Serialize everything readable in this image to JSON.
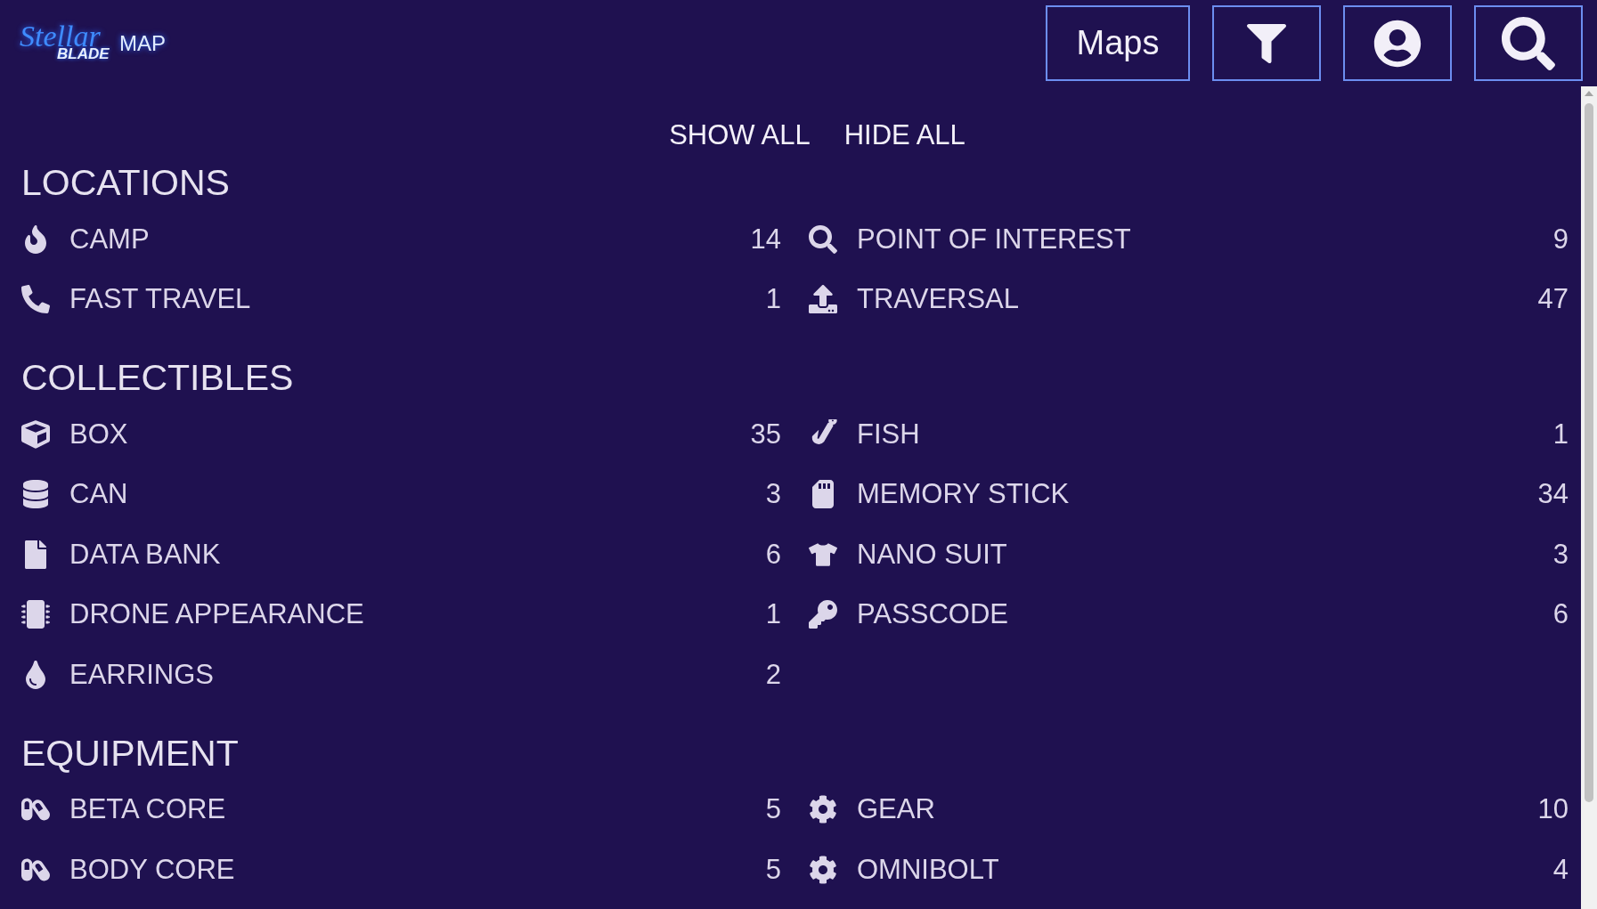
{
  "logo": {
    "script": "Stellar",
    "word": "BLADE",
    "suffix": "MAP"
  },
  "header_buttons": [
    {
      "kind": "text",
      "label": "Maps"
    },
    {
      "kind": "filter"
    },
    {
      "kind": "account"
    },
    {
      "kind": "search"
    }
  ],
  "toggles": [
    "SHOW ALL",
    "HIDE ALL"
  ],
  "sections": [
    {
      "title": "LOCATIONS",
      "items": [
        {
          "label": "CAMP",
          "count": "14"
        },
        {
          "label": "POINT OF INTEREST",
          "count": "9"
        },
        {
          "label": "FAST TRAVEL",
          "count": "1"
        },
        {
          "label": "TRAVERSAL",
          "count": "47"
        }
      ]
    },
    {
      "title": "COLLECTIBLES",
      "items": [
        {
          "label": "BOX",
          "count": "35"
        },
        {
          "label": "FISH",
          "count": "1"
        },
        {
          "label": "CAN",
          "count": "3"
        },
        {
          "label": "MEMORY STICK",
          "count": "34"
        },
        {
          "label": "DATA BANK",
          "count": "6"
        },
        {
          "label": "NANO SUIT",
          "count": "3"
        },
        {
          "label": "DRONE APPEARANCE",
          "count": "1"
        },
        {
          "label": "PASSCODE",
          "count": "6"
        },
        {
          "label": "EARRINGS",
          "count": "2"
        }
      ]
    },
    {
      "title": "EQUIPMENT",
      "items": [
        {
          "label": "BETA CORE",
          "count": "5"
        },
        {
          "label": "GEAR",
          "count": "10"
        },
        {
          "label": "BODY CORE",
          "count": "5"
        },
        {
          "label": "OMNIBOLT",
          "count": "4"
        }
      ]
    }
  ]
}
